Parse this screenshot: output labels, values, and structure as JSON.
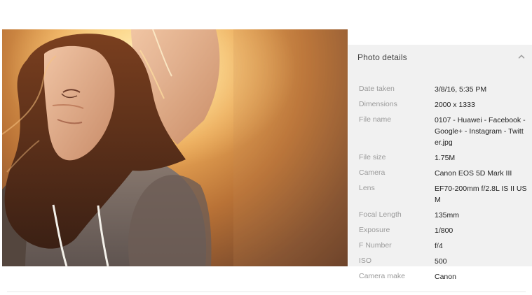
{
  "panel": {
    "title": "Photo details",
    "collapse_icon": "chevron-up-icon"
  },
  "photo": {
    "description_icon": "photo-image"
  },
  "details": [
    {
      "label": "Date taken",
      "value": "3/8/16, 5:35 PM"
    },
    {
      "label": "Dimensions",
      "value": "2000 x 1333"
    },
    {
      "label": "File name",
      "value": "0107 - Huawei - Facebook - Google+ - Instagram - Twitter.jpg"
    },
    {
      "label": "File size",
      "value": "1.75M"
    },
    {
      "label": "Camera",
      "value": "Canon EOS 5D Mark III"
    },
    {
      "label": "Lens",
      "value": "EF70-200mm f/2.8L IS II USM"
    },
    {
      "label": "Focal Length",
      "value": "135mm"
    },
    {
      "label": "Exposure",
      "value": "1/800"
    },
    {
      "label": "F Number",
      "value": "f/4"
    },
    {
      "label": "ISO",
      "value": "500"
    },
    {
      "label": "Camera make",
      "value": "Canon"
    }
  ],
  "colors": {
    "panel_background": "#f1f1f1",
    "label_text": "#9a9a9a",
    "value_text": "#222222"
  }
}
